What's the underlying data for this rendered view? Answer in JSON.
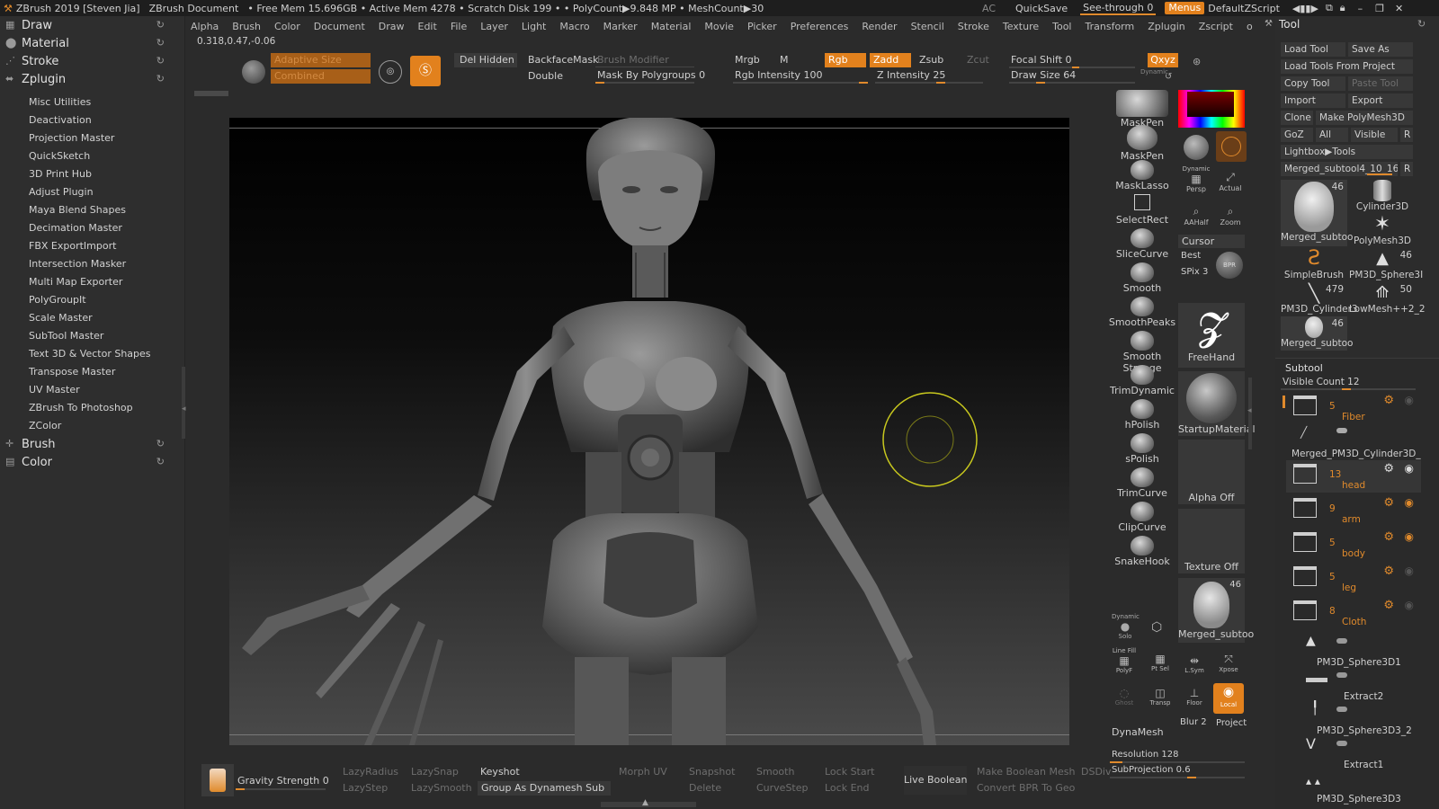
{
  "titlebar": {
    "app": "ZBrush 2019 [Steven Jia]",
    "doc": "ZBrush Document",
    "stats": "• Free Mem 15.696GB • Active Mem 4278 • Scratch Disk 199 • • PolyCount▶9.848 MP • MeshCount▶30",
    "ac": "AC",
    "quicksave": "QuickSave",
    "seethrough": "See-through  0",
    "menus": "Menus",
    "script": "DefaultZScript"
  },
  "menubar": [
    "Alpha",
    "Brush",
    "Color",
    "Document",
    "Draw",
    "Edit",
    "File",
    "Layer",
    "Light",
    "Macro",
    "Marker",
    "Material",
    "Movie",
    "Picker",
    "Preferences",
    "Render",
    "Stencil",
    "Stroke",
    "Texture",
    "Tool",
    "Transform",
    "Zplugin",
    "Zscript",
    "o"
  ],
  "left": {
    "headers": {
      "draw": "Draw",
      "material": "Material",
      "stroke": "Stroke",
      "zplugin": "Zplugin",
      "brush": "Brush",
      "color": "Color"
    },
    "items": [
      "Misc Utilities",
      "Deactivation",
      "Projection Master",
      "QuickSketch",
      "3D Print Hub",
      "Adjust Plugin",
      "Maya Blend Shapes",
      "Decimation Master",
      "FBX ExportImport",
      "Intersection Masker",
      "Multi Map Exporter",
      "PolyGroupIt",
      "Scale Master",
      "SubTool Master",
      "Text 3D & Vector Shapes",
      "Transpose Master",
      "UV Master",
      "ZBrush To Photoshop",
      "ZColor"
    ],
    "coords": "0.318,0.47,-0.06"
  },
  "shelf": {
    "adaptive": "Adaptive Size",
    "combined": "Combined",
    "del_hidden": "Del Hidden",
    "backface": "BackfaceMask",
    "double": "Double",
    "brush_modifier": "Brush Modifier",
    "mask_poly": "Mask By Polygroups 0",
    "mrgb": "Mrgb",
    "m": "M",
    "rgb": "Rgb",
    "zadd": "Zadd",
    "zsub": "Zsub",
    "zcut": "Zcut",
    "rgb_intensity": "Rgb Intensity 100",
    "z_intensity": "Z Intensity 25",
    "focal_shift": "Focal Shift 0",
    "draw_size": "Draw Size 64",
    "dynamic": "Dynamic",
    "xyz": "Qxyz"
  },
  "brushes": [
    "MaskPen",
    "MaskPen",
    "MaskLasso",
    "SelectRect",
    "SliceCurve",
    "Smooth",
    "SmoothPeaks",
    "Smooth Stronge",
    "TrimDynamic",
    "hPolish",
    "sPolish",
    "TrimCurve",
    "ClipCurve",
    "SnakeHook"
  ],
  "right_shelf": {
    "dynamic_persp": "Persp",
    "dynamic_label": "Dynamic",
    "actual": "Actual",
    "aahalf": "AAHalf",
    "zoom": "Zoom",
    "cursor": "Cursor",
    "best": "Best",
    "spix": "SPix 3",
    "bpr": "BPR",
    "freehand": "FreeHand",
    "startup_material": "StartupMaterial",
    "alpha_off": "Alpha Off",
    "texture_off": "Texture Off",
    "merged_thumb": "Merged_subtoo",
    "merged_count": "46",
    "dynamic_solo": "Dynamic",
    "solo": "Solo",
    "line_fill": "Line Fill",
    "polyf": "PolyF",
    "ptsel": "Pt Sel",
    "lsym": "L.Sym",
    "xpose": "Xpose",
    "ghost": "Ghost",
    "transp": "Transp",
    "floor": "Floor",
    "local": "Local",
    "dynamesh": "DynaMesh",
    "blur": "Blur 2",
    "project": "Project",
    "resolution": "Resolution 128",
    "subprojection": "SubProjection 0.6"
  },
  "tool": {
    "title": "Tool",
    "load_tool": "Load Tool",
    "save_as": "Save As",
    "load_from_project": "Load Tools From Project",
    "copy_tool": "Copy Tool",
    "paste_tool": "Paste Tool",
    "import": "Import",
    "export": "Export",
    "clone": "Clone",
    "make_polymesh": "Make PolyMesh3D",
    "goz": "GoZ",
    "all": "All",
    "visible": "Visible",
    "r": "R",
    "lightbox": "Lightbox▶Tools",
    "current_tool": "Merged_subtool4_10_16b",
    "thumbs": [
      {
        "name": "Merged_subtoo",
        "count": "46"
      },
      {
        "name": "Cylinder3D",
        "count": ""
      },
      {
        "name": "PolyMesh3D",
        "count": ""
      },
      {
        "name": "SimpleBrush",
        "count": ""
      },
      {
        "name": "PM3D_Sphere3I",
        "count": "46"
      },
      {
        "name": "PM3D_Cylinder3",
        "count": "479"
      },
      {
        "name": "LowMesh++2_2",
        "count": "50"
      },
      {
        "name": "Merged_subtoo",
        "count": "46"
      }
    ]
  },
  "subtool": {
    "title": "Subtool",
    "visible_count": "Visible Count 12",
    "folders": [
      {
        "count": "5",
        "name": "Fiber"
      },
      {
        "count": "13",
        "name": "head"
      },
      {
        "count": "9",
        "name": "arm"
      },
      {
        "count": "5",
        "name": "body"
      },
      {
        "count": "5",
        "name": "leg"
      },
      {
        "count": "8",
        "name": "Cloth"
      }
    ],
    "merged_label": "Merged_PM3D_Cylinder3D_1(",
    "items": [
      "PM3D_Sphere3D1",
      "Extract2",
      "PM3D_Sphere3D3_2",
      "Extract1",
      "PM3D_Sphere3D3"
    ]
  },
  "bottom": {
    "gravity": "Gravity Strength 0",
    "lazyradius": "LazyRadius",
    "lazysnap": "LazySnap",
    "lazystep": "LazyStep",
    "lazysmooth": "LazySmooth",
    "keyshot": "Keyshot",
    "group_dynamesh": "Group As Dynamesh Sub",
    "morph_uv": "Morph UV",
    "snapshot": "Snapshot",
    "delete": "Delete",
    "smooth": "Smooth",
    "curvestep": "CurveStep",
    "lock_start": "Lock Start",
    "lock_end": "Lock End",
    "live_boolean": "Live Boolean",
    "make_boolean": "Make Boolean Mesh",
    "convert_bpr": "Convert BPR To Geo",
    "dsdiv": "DSDiv"
  },
  "colors": {
    "accent": "#e2811d",
    "bg": "#2b2b2b",
    "panel": "#2e2e2e",
    "cursor": "#c8c81e"
  }
}
